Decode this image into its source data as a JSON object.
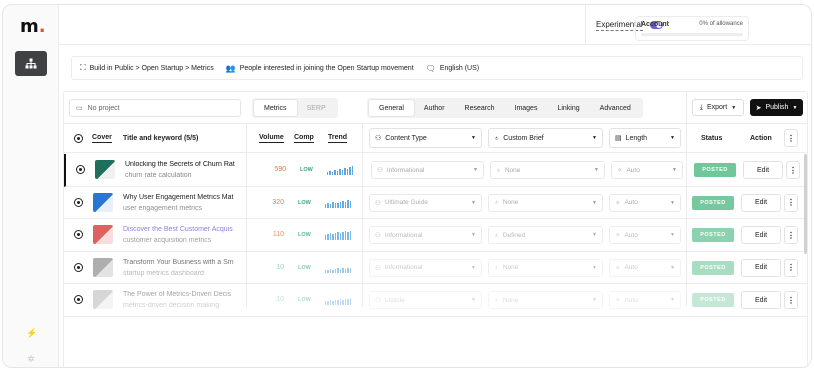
{
  "app": {
    "logo_text": "m",
    "logo_dot": "."
  },
  "header": {
    "experimental_label": "Experimental",
    "experimental_on": true,
    "account_label": "Account",
    "allowance_text": "0% of allowance",
    "allowance_fraction": 0
  },
  "breadcrumbs": {
    "path": "Build in Public > Open Startup > Metrics",
    "audience": "People interested in joining the Open Startup movement",
    "language": "English (US)"
  },
  "toolbar": {
    "search_placeholder": "No project",
    "metric_tabs": [
      {
        "label": "Metrics",
        "active": true
      },
      {
        "label": "SERP",
        "active": false
      }
    ],
    "view_tabs": [
      {
        "label": "General",
        "active": true
      },
      {
        "label": "Author",
        "active": false
      },
      {
        "label": "Research",
        "active": false
      },
      {
        "label": "Images",
        "active": false
      },
      {
        "label": "Linking",
        "active": false
      },
      {
        "label": "Advanced",
        "active": false
      }
    ],
    "export_label": "Export",
    "publish_label": "Publish"
  },
  "table": {
    "headers": {
      "cover": "Cover",
      "title": "Title and keyword (5/5)",
      "volume": "Volume",
      "comp": "Comp",
      "trend": "Trend",
      "content_type": "Content Type",
      "custom_brief": "Custom Brief",
      "length": "Length",
      "status": "Status",
      "action": "Action"
    },
    "rows": [
      {
        "title": "Unlocking the Secrets of Churn Rat",
        "keyword": "churn rate calculation",
        "volume": "590",
        "volume_color": "#e07b39",
        "comp": "LOW",
        "trend": [
          3,
          4,
          3,
          5,
          4,
          6,
          5,
          7,
          6,
          8,
          9
        ],
        "content_type": "Informational",
        "brief": "None",
        "length": "Auto",
        "status": "POSTED",
        "action": "Edit",
        "title_link": false,
        "opacity": 1,
        "thumb_colors": [
          "#1f6f5c",
          "#f0f0f0"
        ]
      },
      {
        "title": "Why User Engagement Metrics Mat",
        "keyword": "user engagement metrics",
        "volume": "320",
        "volume_color": "#e07b39",
        "comp": "LOW",
        "trend": [
          4,
          5,
          4,
          6,
          5,
          5,
          6,
          7,
          6,
          8,
          7
        ],
        "content_type": "Ultimate Guide",
        "brief": "None",
        "length": "Auto",
        "status": "POSTED",
        "action": "Edit",
        "title_link": false,
        "opacity": 0.95,
        "thumb_colors": [
          "#1e6fd0",
          "#e8eef8"
        ]
      },
      {
        "title": "Discover the Best Customer Acquis",
        "keyword": "customer acquisition metrics",
        "volume": "110",
        "volume_color": "#e07b39",
        "comp": "LOW",
        "trend": [
          5,
          6,
          7,
          6,
          7,
          8,
          7,
          8,
          9,
          8,
          9
        ],
        "content_type": "Informational",
        "brief": "Defined",
        "length": "Auto",
        "status": "POSTED",
        "action": "Edit",
        "title_link": true,
        "opacity": 0.8,
        "thumb_colors": [
          "#d43b3b",
          "#f5d6d6"
        ]
      },
      {
        "title": "Transform Your Business with a Sm",
        "keyword": "startup metrics dashboard",
        "volume": "10",
        "volume_color": "#4fb3a0",
        "comp": "LOW",
        "trend": [
          3,
          3,
          4,
          3,
          4,
          5,
          4,
          5,
          4,
          5,
          5
        ],
        "content_type": "Informational",
        "brief": "None",
        "length": "Auto",
        "status": "POSTED",
        "action": "Edit",
        "title_link": false,
        "opacity": 0.6,
        "thumb_colors": [
          "#777777",
          "#d0d0d0"
        ]
      },
      {
        "title": "The Power of Metrics-Driven Decis",
        "keyword": "metrics-driven decision making",
        "volume": "10",
        "volume_color": "#4fb3a0",
        "comp": "LOW",
        "trend": [
          4,
          4,
          5,
          4,
          5,
          5,
          6,
          5,
          6,
          6,
          7
        ],
        "content_type": "Listicle",
        "brief": "None",
        "length": "Auto",
        "status": "POSTED",
        "action": "Edit",
        "title_link": false,
        "opacity": 0.4,
        "thumb_colors": [
          "#9a9a9a",
          "#e3e3e3"
        ]
      }
    ]
  },
  "colors": {
    "accent": "#6c5dd3",
    "posted": "#6fc79a",
    "trend": "#5aa9e6",
    "comp_low": "#3aa37a"
  }
}
